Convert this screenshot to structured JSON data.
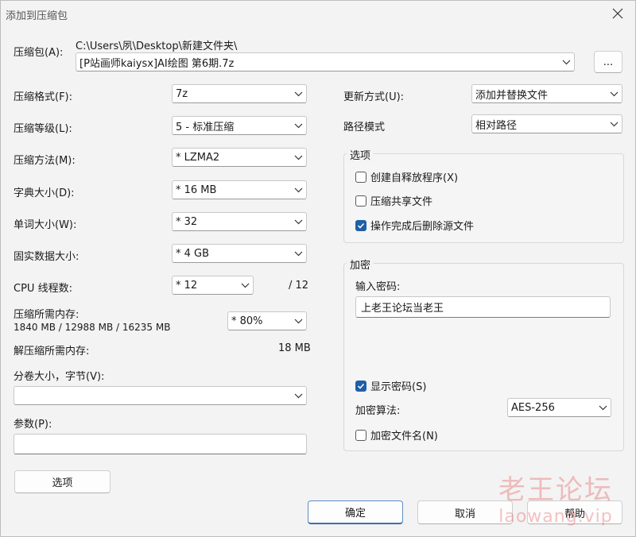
{
  "window": {
    "title": "添加到压缩包"
  },
  "archive": {
    "label": "压缩包(A):",
    "path": "C:\\Users\\夙\\Desktop\\新建文件夹\\",
    "filename": "[P站画师kaiysx]AI绘图   第6期.7z",
    "browse_label": "..."
  },
  "left": {
    "format": {
      "label": "压缩格式(F):",
      "value": "7z"
    },
    "level": {
      "label": "压缩等级(L):",
      "value": "5 - 标准压缩"
    },
    "method": {
      "label": "压缩方法(M):",
      "value": "*  LZMA2"
    },
    "dict": {
      "label": "字典大小(D):",
      "value": "*  16 MB"
    },
    "word": {
      "label": "单词大小(W):",
      "value": "*  32"
    },
    "solid": {
      "label": "固实数据大小:",
      "value": "*  4 GB"
    },
    "threads": {
      "label": "CPU 线程数:",
      "value": "*  12",
      "max": "/ 12"
    },
    "mem_comp": {
      "label": "压缩所需内存:",
      "detail": "1840 MB / 12988 MB / 16235 MB",
      "value": "* 80%"
    },
    "mem_decomp": {
      "label": "解压缩所需内存:",
      "value": "18 MB"
    },
    "volume": {
      "label": "分卷大小，字节(V):",
      "value": ""
    },
    "params": {
      "label": "参数(P):",
      "value": ""
    },
    "options_btn": "选项"
  },
  "right": {
    "update": {
      "label": "更新方式(U):",
      "value": "添加并替换文件"
    },
    "pathmode": {
      "label": "路径模式",
      "value": "相对路径"
    },
    "options_group": {
      "title": "选项",
      "sfx": {
        "label": "创建自释放程序(X)",
        "checked": false
      },
      "shared": {
        "label": "压缩共享文件",
        "checked": false
      },
      "delete": {
        "label": "操作完成后删除源文件",
        "checked": true
      }
    },
    "encryption": {
      "title": "加密",
      "pwd_label": "输入密码:",
      "pwd_value": "上老王论坛当老王",
      "show": {
        "label": "显示密码(S)",
        "checked": true
      },
      "algo_label": "加密算法:",
      "algo_value": "AES-256",
      "encnames": {
        "label": "加密文件名(N)",
        "checked": false
      }
    }
  },
  "buttons": {
    "ok": "确定",
    "cancel": "取消",
    "help": "帮助"
  },
  "watermark": {
    "line1": "老王论坛",
    "line2": "laowang.vip"
  }
}
